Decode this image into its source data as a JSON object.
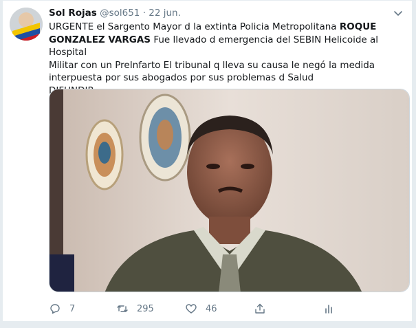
{
  "tweet": {
    "author_name": "Sol Rojas",
    "author_handle": "@sol651",
    "separator": "·",
    "date": "22 jun.",
    "text_line1_pre": "URGENTE el Sargento Mayor d la extinta Policia Metropolitana ",
    "text_line1_bold": "ROQUE",
    "text_line2_bold": "GONZALEZ VARGAS",
    "text_line2_rest": " Fue llevado d emergencia del SEBIN Helicoide al Hospital",
    "text_line3": "Militar con un PreInfarto El tribunal q lleva su causa le negó la medida",
    "text_line4": "interpuesta por sus abogados por sus problemas d Salud",
    "text_line5": "DIFUNDIR"
  },
  "actions": {
    "reply_count": "7",
    "retweet_count": "295",
    "like_count": "46"
  },
  "colors": {
    "background": "#e6ecf0",
    "muted": "#657786",
    "text": "#14171a"
  },
  "icons": [
    "chevron-down-icon",
    "reply-icon",
    "retweet-icon",
    "like-icon",
    "share-icon",
    "analytics-icon"
  ]
}
